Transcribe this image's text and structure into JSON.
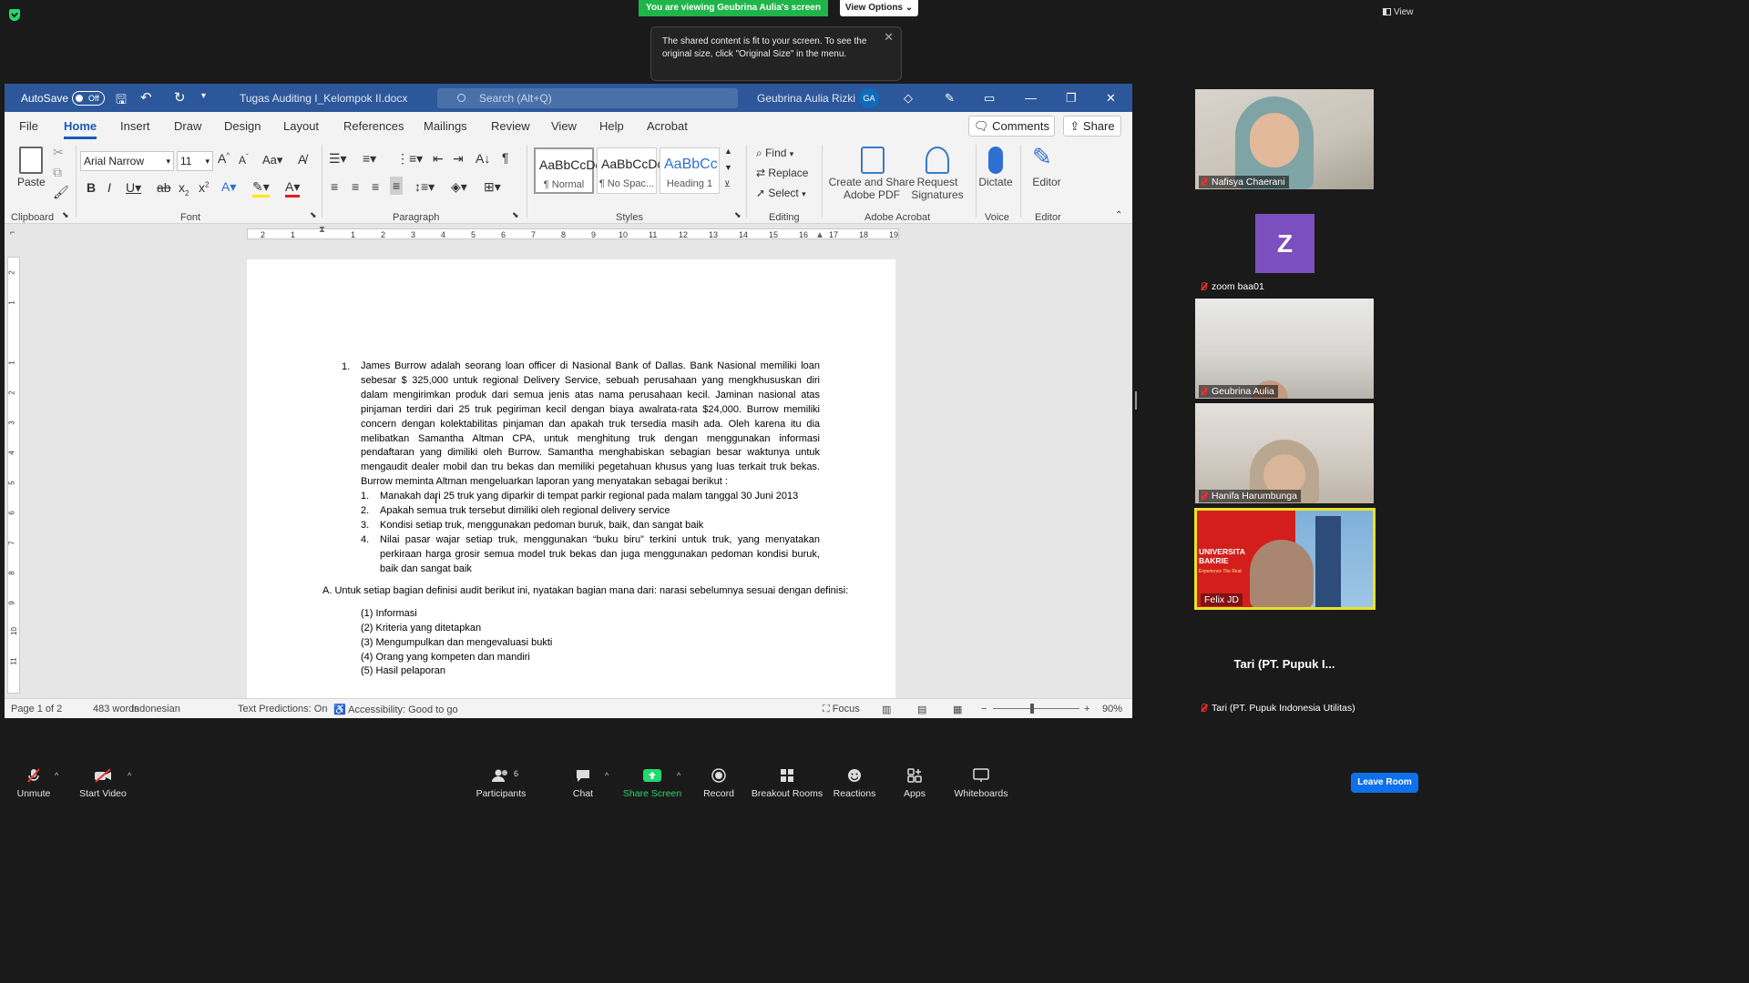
{
  "zoom": {
    "viewing_banner": "You are viewing Geubrina Aulia's screen",
    "view_options": "View Options",
    "view_button": "View",
    "tooltip": "The shared content is fit to your screen. To see the original size, click \"Original Size\" in the menu.",
    "participants": [
      {
        "name": "Nafisya Chaerani"
      },
      {
        "name": "zoom baa01",
        "avatar_letter": "Z",
        "avatar_color": "#7b4fbe"
      },
      {
        "name": "Geubrina Aulia"
      },
      {
        "name": "Hanifa Harumbunga"
      },
      {
        "name": "Felix JD"
      },
      {
        "name": "Tari (PT. Pupuk Indonesia Utilitas)",
        "display_big": "Tari (PT. Pupuk I..."
      }
    ],
    "felix_background": {
      "line1": "UNIVERSITA",
      "line2": "BAKRIE",
      "line3": "Experience The Real"
    },
    "toolbar": {
      "unmute": "Unmute",
      "start_video": "Start Video",
      "participants": "Participants",
      "participants_count": "6",
      "chat": "Chat",
      "share_screen": "Share Screen",
      "record": "Record",
      "breakout_rooms": "Breakout Rooms",
      "reactions": "Reactions",
      "apps": "Apps",
      "whiteboards": "Whiteboards",
      "leave": "Leave Room"
    },
    "colors": {
      "share_green": "#20b54a",
      "leave_blue": "#0e71eb",
      "active_speaker": "#e8e22a"
    }
  },
  "word": {
    "autosave_label": "AutoSave",
    "autosave_state": "Off",
    "doc_title": "Tugas Auditing I_Kelompok II.docx",
    "search_placeholder": "Search (Alt+Q)",
    "user_name": "Geubrina Aulia Rizki",
    "user_initials": "GA",
    "menu_tabs": [
      "File",
      "Home",
      "Insert",
      "Draw",
      "Design",
      "Layout",
      "References",
      "Mailings",
      "Review",
      "View",
      "Help",
      "Acrobat"
    ],
    "comments_label": "Comments",
    "share_label": "Share",
    "ribbon": {
      "paste": "Paste",
      "font_name": "Arial Narrow",
      "font_size": "11",
      "styles": [
        {
          "sample": "AaBbCcDc",
          "name": "¶ Normal"
        },
        {
          "sample": "AaBbCcDc",
          "name": "¶ No Spac..."
        },
        {
          "sample": "AaBbCc",
          "name": "Heading 1"
        }
      ],
      "find": "Find",
      "replace": "Replace",
      "select": "Select",
      "create_share_pdf_1": "Create and Share",
      "create_share_pdf_2": "Adobe PDF",
      "request_sig_1": "Request",
      "request_sig_2": "Signatures",
      "dictate": "Dictate",
      "editor": "Editor",
      "group_labels": [
        "Clipboard",
        "Font",
        "Paragraph",
        "Styles",
        "Editing",
        "Adobe Acrobat",
        "Voice",
        "Editor"
      ]
    },
    "ruler_ticks": [
      "2",
      "1",
      "1",
      "2",
      "3",
      "4",
      "5",
      "6",
      "7",
      "8",
      "9",
      "10",
      "11",
      "12",
      "13",
      "14",
      "15",
      "16",
      "17",
      "18",
      "19"
    ],
    "vruler_ticks": [
      "2",
      "1",
      "1",
      "2",
      "3",
      "4",
      "5",
      "6",
      "7",
      "8",
      "9",
      "10",
      "11"
    ],
    "document": {
      "question_number": "1.",
      "question_paragraph": "James Burrow adalah seorang loan officer di Nasional Bank of Dallas. Bank Nasional memiliki loan sebesar $ 325,000 untuk regional Delivery Service, sebuah perusahaan yang mengkhususkan diri dalam mengirimkan produk dari semua jenis atas nama perusahaan kecil. Jaminan nasional atas pinjaman terdiri dari 25 truk pegiriman kecil dengan biaya awalrata-rata $24,000. Burrow memiliki concern dengan kolektabilitas pinjaman dan apakah truk tersedia masih ada. Oleh karena itu dia melibatkan Samantha Altman CPA, untuk menghitung truk dengan menggunakan informasi pendaftaran yang dimiliki oleh Burrow. Samantha menghabiskan sebagian besar waktunya untuk mengaudit dealer mobil dan tru bekas dan memiliki pegetahuan khusus yang luas terkait truk bekas. Burrow meminta Altman mengeluarkan laporan yang menyatakan sebagai berikut :",
      "sub_items": [
        {
          "n": "1.",
          "text": "Manakah dari 25 truk yang diparkir di tempat parkir regional pada malam tanggal 30 Juni 2013"
        },
        {
          "n": "2.",
          "text": "Apakah semua truk tersebut dimiliki oleh regional delivery service"
        },
        {
          "n": "3.",
          "text": "Kondisi setiap truk, menggunakan pedoman buruk, baik, dan sangat baik"
        },
        {
          "n": "4.",
          "text": "Nilai pasar wajar setiap truk, menggunakan “buku biru” terkini untuk truk, yang menyatakan perkiraan harga grosir semua model truk bekas dan juga menggunakan pedoman kondisi buruk, baik dan sangat baik"
        }
      ],
      "part_a": "A. Untuk setiap bagian definisi audit berikut ini, nyatakan bagian mana dari: narasi sebelumnya sesuai dengan definisi:",
      "definitions": [
        "(1) Informasi",
        "(2) Kriteria yang ditetapkan",
        "(3) Mengumpulkan dan mengevaluasi bukti",
        "(4) Orang yang kompeten dan mandiri",
        "(5) Hasil pelaporan"
      ]
    },
    "status": {
      "page": "Page 1 of 2",
      "words": "483 words",
      "language": "Indonesian",
      "text_predictions": "Text Predictions: On",
      "accessibility": "Accessibility: Good to go",
      "focus": "Focus",
      "zoom": "90%"
    }
  }
}
